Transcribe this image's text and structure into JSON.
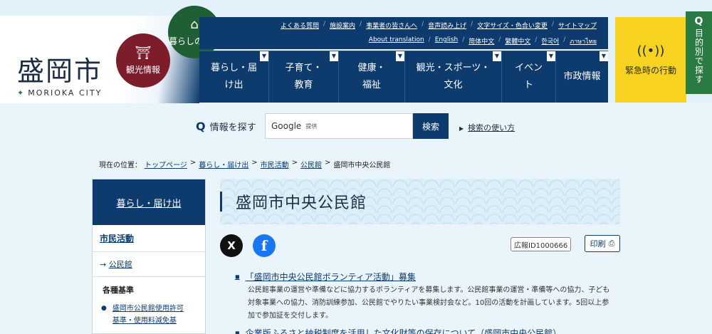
{
  "header": {
    "logo": "盛岡市",
    "logo_sub": "MORIOKA CITY",
    "circle_living": "暮らしの情報",
    "circle_sightseeing": "観光情報",
    "utility_row1": [
      "よくある質問",
      "施設案内",
      "事業者の皆さんへ",
      "音声読み上げ",
      "文字サイズ・色合い変更",
      "サイトマップ"
    ],
    "utility_row2": [
      "About translation",
      "English",
      "简体中文",
      "繁體中文",
      "한국어",
      "ภาษาไทย"
    ],
    "nav": [
      "暮らし・届け出",
      "子育て・教育",
      "健康・福祉",
      "観光・スポーツ・文化",
      "イベント",
      "市政情報"
    ],
    "emergency": "緊急時の行動",
    "purpose": "目的別で探す"
  },
  "search": {
    "label": "情報を探す",
    "provider": "Google",
    "provided": "提供",
    "button": "検索",
    "help": "検索の使い方"
  },
  "breadcrumb": {
    "prefix": "現在の位置：",
    "items": [
      "トップページ",
      "暮らし・届け出",
      "市民活動",
      "公民館"
    ],
    "current": "盛岡市中央公民館"
  },
  "sidebar": {
    "heading": "暮らし・届け出",
    "section": "市民活動",
    "sub": "公民館",
    "group": "各種基準",
    "link_line1": "盛岡市公民館使用許可",
    "link_line2": "基準・使用料減免基"
  },
  "main": {
    "title": "盛岡市中央公民館",
    "pr_id": "広報ID1000666",
    "print": "印刷",
    "article": [
      {
        "title": "「盛岡市中央公民館ボランティア活動」募集",
        "desc": "公民館事業の運営や準備などに協力するボランティアを募集します。公民館事業の運営・準備等への協力、子ども対象事業への協力、消防訓練参加、公民館でやりたい事業検討会など。10回の活動を計画しています。5回以上参加で参加証を交付します。"
      },
      {
        "title": "企業版ふるさと納税制度を活用した文化財等の保存について（盛岡市中央公民館）",
        "desc": ""
      }
    ]
  }
}
